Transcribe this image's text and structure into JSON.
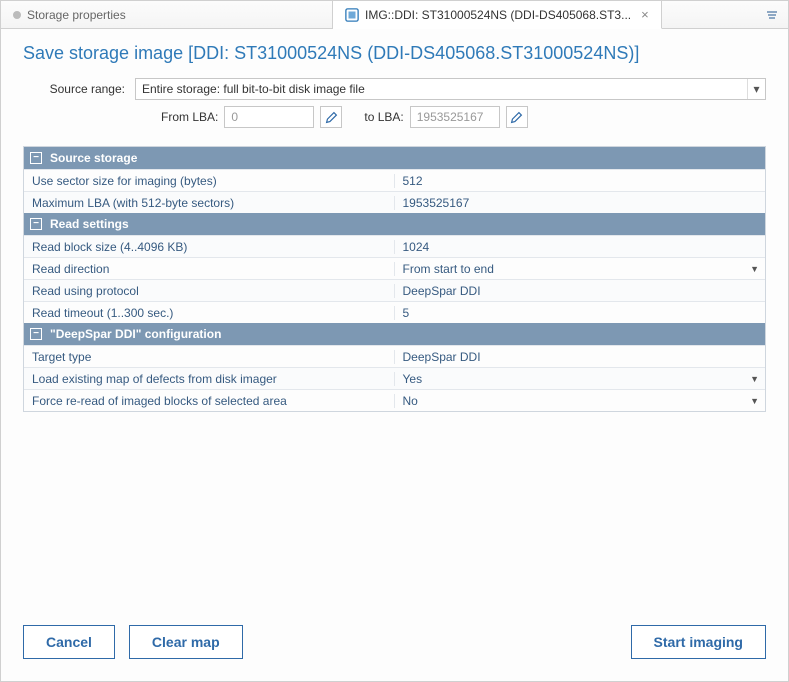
{
  "tabs": {
    "inactive_label": "Storage properties",
    "active_label": "IMG::DDI: ST31000524NS (DDI-DS405068.ST3..."
  },
  "title": "Save storage image [DDI: ST31000524NS (DDI-DS405068.ST31000524NS)]",
  "source_range": {
    "label": "Source range:",
    "value": "Entire storage: full bit-to-bit disk image file",
    "from_label": "From LBA:",
    "from_value": "0",
    "to_label": "to LBA:",
    "to_value": "1953525167"
  },
  "sections": {
    "source_storage": {
      "title": "Source storage",
      "rows": [
        {
          "label": "Use sector size for imaging (bytes)",
          "value": "512",
          "dropdown": false
        },
        {
          "label": "Maximum LBA (with 512-byte sectors)",
          "value": "1953525167",
          "dropdown": false
        }
      ]
    },
    "read_settings": {
      "title": "Read settings",
      "rows": [
        {
          "label": "Read block size (4..4096 KB)",
          "value": "1024",
          "dropdown": false
        },
        {
          "label": "Read direction",
          "value": "From start to end",
          "dropdown": true
        },
        {
          "label": "Read using protocol",
          "value": "DeepSpar DDI",
          "dropdown": false
        },
        {
          "label": "Read timeout (1..300 sec.)",
          "value": "5",
          "dropdown": false
        }
      ]
    },
    "ddi_config": {
      "title": "\"DeepSpar DDI\" configuration",
      "rows": [
        {
          "label": "Target type",
          "value": "DeepSpar DDI",
          "dropdown": false
        },
        {
          "label": "Load existing map of defects from disk imager",
          "value": "Yes",
          "dropdown": true
        },
        {
          "label": "Force re-read of imaged blocks of selected area",
          "value": "No",
          "dropdown": true
        }
      ]
    }
  },
  "buttons": {
    "cancel": "Cancel",
    "clear_map": "Clear map",
    "start": "Start imaging"
  }
}
